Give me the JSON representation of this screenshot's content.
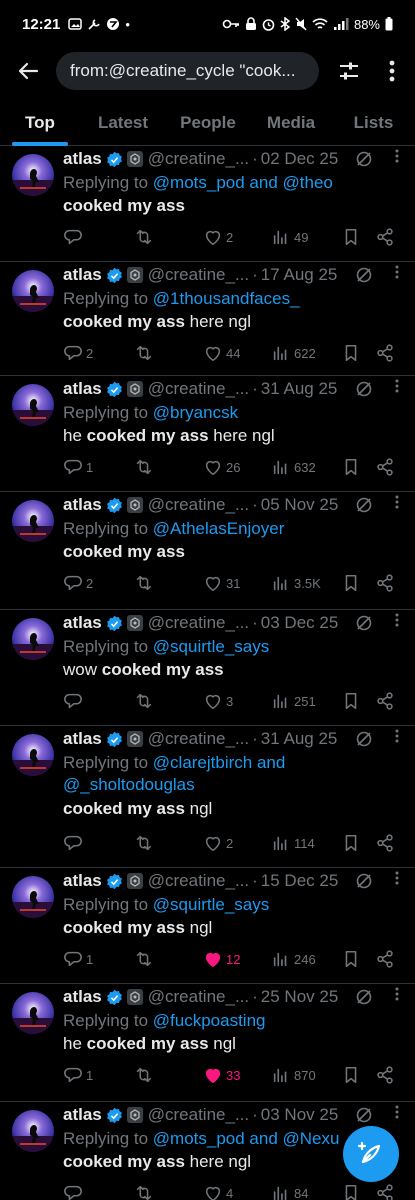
{
  "status_bar": {
    "time": "12:21",
    "battery": "88%"
  },
  "search": {
    "query": "from:@creatine_cycle \"cook..."
  },
  "tabs": [
    {
      "label": "Top",
      "active": true
    },
    {
      "label": "Latest",
      "active": false
    },
    {
      "label": "People",
      "active": false
    },
    {
      "label": "Media",
      "active": false
    },
    {
      "label": "Lists",
      "active": false
    }
  ],
  "accent_color": "#1d9bf0",
  "like_color": "#f91880",
  "tweets": [
    {
      "name": "atlas",
      "handle": "@creatine_...",
      "date": "02 Dec 25",
      "replying_prefix": "Replying to ",
      "mentions": "@mots_pod and @theo",
      "mentions_2": "",
      "text_before": "",
      "text_bold": "cooked my ass",
      "text_after": "",
      "replies": "",
      "reposts": "",
      "likes": "2",
      "views": "49",
      "liked": false
    },
    {
      "name": "atlas",
      "handle": "@creatine_...",
      "date": "17 Aug 25",
      "replying_prefix": "Replying to ",
      "mentions": "@1thousandfaces_",
      "mentions_2": "",
      "text_before": "",
      "text_bold": "cooked my ass",
      "text_after": " here ngl",
      "replies": "2",
      "reposts": "",
      "likes": "44",
      "views": "622",
      "liked": false
    },
    {
      "name": "atlas",
      "handle": "@creatine_...",
      "date": "31 Aug 25",
      "replying_prefix": "Replying to ",
      "mentions": "@bryancsk",
      "mentions_2": "",
      "text_before": "he ",
      "text_bold": "cooked my ass",
      "text_after": " here ngl",
      "replies": "1",
      "reposts": "",
      "likes": "26",
      "views": "632",
      "liked": false
    },
    {
      "name": "atlas",
      "handle": "@creatine_...",
      "date": "05 Nov 25",
      "replying_prefix": "Replying to ",
      "mentions": "@AthelasEnjoyer",
      "mentions_2": "",
      "text_before": "",
      "text_bold": "cooked my ass",
      "text_after": "",
      "replies": "2",
      "reposts": "",
      "likes": "31",
      "views": "3.5K",
      "liked": false
    },
    {
      "name": "atlas",
      "handle": "@creatine_...",
      "date": "03 Dec 25",
      "replying_prefix": "Replying to ",
      "mentions": "@squirtle_says",
      "mentions_2": "",
      "text_before": "wow ",
      "text_bold": "cooked my ass",
      "text_after": "",
      "replies": "",
      "reposts": "",
      "likes": "3",
      "views": "251",
      "liked": false
    },
    {
      "name": "atlas",
      "handle": "@creatine_...",
      "date": "31 Aug 25",
      "replying_prefix": "Replying to ",
      "mentions": "@clarejtbirch and",
      "mentions_2": "@_sholtodouglas",
      "text_before": "",
      "text_bold": "cooked my ass",
      "text_after": " ngl",
      "replies": "",
      "reposts": "",
      "likes": "2",
      "views": "114",
      "liked": false
    },
    {
      "name": "atlas",
      "handle": "@creatine_...",
      "date": "15 Dec 25",
      "replying_prefix": "Replying to ",
      "mentions": "@squirtle_says",
      "mentions_2": "",
      "text_before": "",
      "text_bold": "cooked my ass",
      "text_after": " ngl",
      "replies": "1",
      "reposts": "",
      "likes": "12",
      "views": "246",
      "liked": true
    },
    {
      "name": "atlas",
      "handle": "@creatine_...",
      "date": "25 Nov 25",
      "replying_prefix": "Replying to ",
      "mentions": "@fuckpoasting",
      "mentions_2": "",
      "text_before": "he ",
      "text_bold": "cooked my ass",
      "text_after": " ngl",
      "replies": "1",
      "reposts": "",
      "likes": "33",
      "views": "870",
      "liked": true
    },
    {
      "name": "atlas",
      "handle": "@creatine_...",
      "date": "03 Nov 25",
      "replying_prefix": "Replying to ",
      "mentions": "@mots_pod and @Nexu",
      "mentions_2": "",
      "text_before": "",
      "text_bold": "cooked my ass",
      "text_after": " here ngl",
      "replies": "",
      "reposts": "",
      "likes": "4",
      "views": "84",
      "liked": false
    }
  ],
  "icons": {
    "back": "arrow-left-icon",
    "filter": "sliders-icon",
    "more": "more-vertical-icon",
    "verified": "verified-badge-icon",
    "grok": "grok-icon",
    "reply": "reply-icon",
    "repost": "repost-icon",
    "like": "heart-icon",
    "views": "views-icon",
    "bookmark": "bookmark-icon",
    "share": "share-icon",
    "compose": "compose-icon"
  }
}
